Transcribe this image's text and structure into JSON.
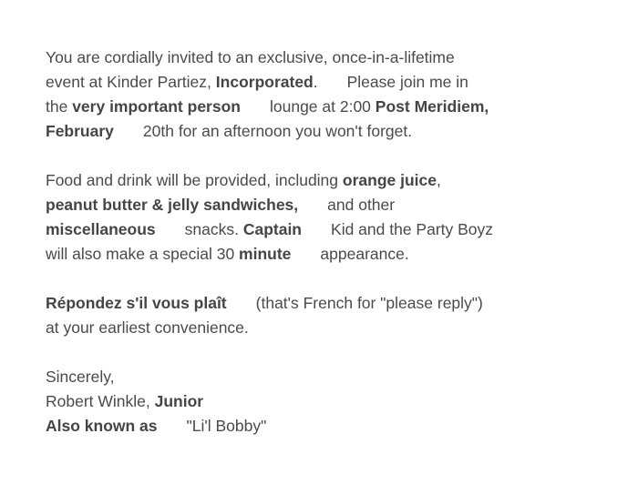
{
  "letter": {
    "para1": {
      "l1": "You are cordially invited to an exclusive, once-in-a-lifetime",
      "l2a": "event at Kinder Partiez, ",
      "l2b": "Incorporated",
      "l2c": ".",
      "l2d": "Please join me in",
      "l3a": "the ",
      "l3b": "very important person",
      "l3c": "lounge at 2:00 ",
      "l3d": "Post Meridiem",
      "l3e": ",",
      "l4a": "February",
      "l4b": "20th for an afternoon you won't forget."
    },
    "para2": {
      "l1a": "Food and drink will be provided, including ",
      "l1b": "orange juice",
      "l1c": ",",
      "l2a": "peanut butter & jelly sandwiches,",
      "l2b": "and other",
      "l3a": "miscellaneous",
      "l3b": "snacks. ",
      "l3c": "Captain",
      "l3d": "Kid and the Party Boyz",
      "l4a": "will also make a special 30 ",
      "l4b": "minute",
      "l4c": "appearance."
    },
    "para3": {
      "l1a": "Répondez s'il vous plaît",
      "l1b": "(that's French for \"please reply\")",
      "l2": "at your earliest convenience."
    },
    "para4": {
      "l1": "Sincerely,",
      "l2a": "Robert Winkle, ",
      "l2b": "Junior",
      "l3a": "Also known as",
      "l3b": "\"Li'l Bobby\""
    }
  }
}
